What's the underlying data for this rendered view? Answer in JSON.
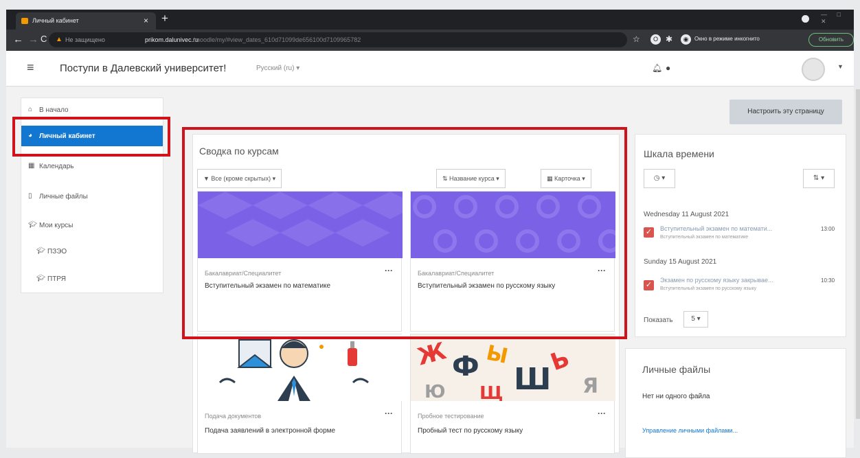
{
  "browser": {
    "tab_title": "Личный кабинет",
    "close_tab": "×",
    "new_tab": "+",
    "not_secure": "Не защищено",
    "host": "prikom.dalunivec.ru",
    "path": "/moodle/my/#view_dates_610d71099de656100d7109965782",
    "incognito_label": "Окно в режиме инкогнито",
    "update_label": "Обновить"
  },
  "navbar": {
    "site_name": "Поступи в Далевский университет!",
    "language": "Русский (ru) ▾"
  },
  "sidebar": {
    "items": [
      {
        "label": "В начало"
      },
      {
        "label": "Личный кабинет"
      },
      {
        "label": "Календарь"
      },
      {
        "label": "Личные файлы"
      },
      {
        "label": "Мои курсы"
      },
      {
        "label": "ПЗЭО"
      },
      {
        "label": "ПТРЯ"
      }
    ]
  },
  "main": {
    "customize_button": "Настроить эту страницу",
    "overview_title": "Сводка по курсам",
    "filter_button": "Все (кроме скрытых) ▾",
    "sort_button": "Название курса ▾",
    "view_button": "Карточка ▾",
    "courses": [
      {
        "category": "Бакалавриат/Специалитет",
        "name": "Вступительный экзамен по математике"
      },
      {
        "category": "Бакалавриат/Специалитет",
        "name": "Вступительный экзамен по русскому языку"
      },
      {
        "category": "Подача документов",
        "name": "Подача заявлений в электронной форме"
      },
      {
        "category": "Пробное тестирование",
        "name": "Пробный тест по русскому языку"
      }
    ]
  },
  "timeline": {
    "title": "Шкала времени",
    "groups": [
      {
        "date": "Wednesday 11 August 2021",
        "event": "Вступительный экзамен по математи...",
        "course": "Вступительный экзамен по математике",
        "time": "13:00"
      },
      {
        "date": "Sunday 15 August 2021",
        "event": "Экзамен по русскому языку закрывае...",
        "course": "Вступительный экзамен по русскому языку",
        "time": "10:30"
      }
    ],
    "show_label": "Показать",
    "show_count": "5 ▾"
  },
  "private_files": {
    "title": "Личные файлы",
    "empty_text": "Нет ни одного файла",
    "manage_link": "Управление личными файлами..."
  },
  "colors": {
    "accent": "#1177d1",
    "highlight": "#d0121b",
    "course_banner": "#7b61e6"
  }
}
